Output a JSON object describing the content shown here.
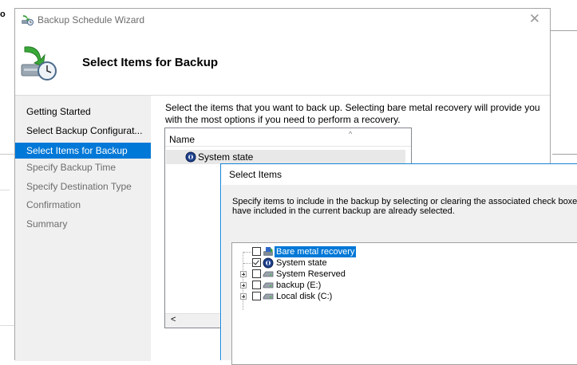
{
  "background": {
    "fragment_text": "o"
  },
  "wizard": {
    "title": "Backup Schedule Wizard",
    "close_glyph": "✕",
    "header_title": "Select Items for Backup",
    "nav": [
      {
        "label": "Getting Started",
        "state": "normal"
      },
      {
        "label": "Select Backup Configurat...",
        "state": "normal"
      },
      {
        "label": "Select Items for Backup",
        "state": "active"
      },
      {
        "label": "Specify Backup Time",
        "state": "disabled"
      },
      {
        "label": "Specify Destination Type",
        "state": "disabled"
      },
      {
        "label": "Confirmation",
        "state": "disabled"
      },
      {
        "label": "Summary",
        "state": "disabled"
      }
    ],
    "description": "Select the items that you want to back up. Selecting bare metal recovery will provide you with the most options if you need to perform a recovery.",
    "list": {
      "column_name": "Name",
      "sort_glyph": "^",
      "items": [
        {
          "label": "System state",
          "icon": "system-state-icon"
        }
      ],
      "scroll_left_glyph": "<"
    }
  },
  "dialog": {
    "title": "Select Items",
    "description_line1": "Specify items to include in the backup by selecting or clearing the associated check boxes. The",
    "description_line2": "have included in the current backup are already selected.",
    "tree": [
      {
        "label": "Bare metal recovery",
        "checked": false,
        "selected": true,
        "expandable": false,
        "icon": "bare-metal-recovery-icon"
      },
      {
        "label": "System state",
        "checked": true,
        "selected": false,
        "expandable": false,
        "icon": "system-state-icon"
      },
      {
        "label": "System Reserved",
        "checked": false,
        "selected": false,
        "expandable": true,
        "icon": "drive-icon"
      },
      {
        "label": "backup (E:)",
        "checked": false,
        "selected": false,
        "expandable": true,
        "icon": "drive-icon"
      },
      {
        "label": "Local disk (C:)",
        "checked": false,
        "selected": false,
        "expandable": true,
        "icon": "drive-icon"
      }
    ]
  },
  "colors": {
    "accent": "#0078d7",
    "dialog_border": "#1883d7",
    "nav_bg": "#f0f0f0"
  }
}
